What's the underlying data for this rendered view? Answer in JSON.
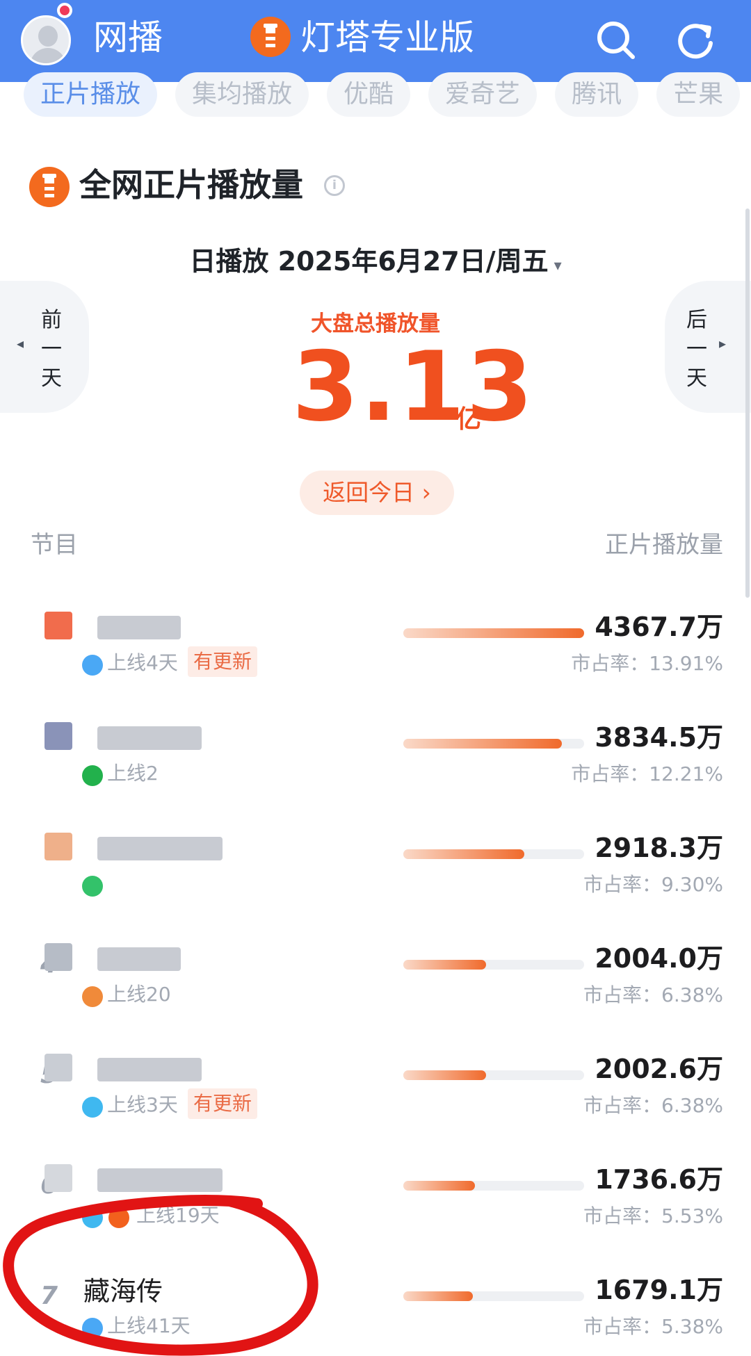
{
  "header": {
    "title": "网播",
    "brand": "灯塔专业版",
    "color": "#4d86f0"
  },
  "tabs": [
    {
      "label": "正片播放",
      "active": true
    },
    {
      "label": "集均播放",
      "active": false
    },
    {
      "label": "优酷",
      "active": false
    },
    {
      "label": "爱奇艺",
      "active": false
    },
    {
      "label": "腾讯",
      "active": false
    },
    {
      "label": "芒果",
      "active": false
    }
  ],
  "section": {
    "title": "全网正片播放量",
    "info_icon": "info-icon"
  },
  "date": {
    "label": "日播放 2025年6月27日/周五",
    "caret": "▾"
  },
  "nav": {
    "prev": "前一天",
    "next": "后一天",
    "prev_arrow": "◂",
    "next_arrow": "▸"
  },
  "total": {
    "label": "大盘总播放量",
    "value": "3.13",
    "unit": "亿"
  },
  "back_today": "返回今日 ›",
  "columns": {
    "left": "节目",
    "right": "正片播放量"
  },
  "rows": [
    {
      "rank": "",
      "title": "",
      "meta": "上线4天",
      "tag": "有更新",
      "plays": "4367.7万",
      "share": "市占率：13.91%",
      "bar": 1.0,
      "platforms": [
        "#4aa8f5"
      ]
    },
    {
      "rank": "",
      "title": "",
      "meta": "上线2",
      "tag": "",
      "plays": "3834.5万",
      "share": "市占率：12.21%",
      "bar": 0.878,
      "platforms": [
        "#22b14c"
      ]
    },
    {
      "rank": "",
      "title": "",
      "meta": "",
      "tag": "",
      "plays": "2918.3万",
      "share": "市占率：9.30%",
      "bar": 0.668,
      "platforms": [
        "#33c26a"
      ]
    },
    {
      "rank": "4",
      "title": "",
      "meta": "上线20",
      "tag": "",
      "plays": "2004.0万",
      "share": "市占率：6.38%",
      "bar": 0.459,
      "platforms": [
        "#f08a3a"
      ]
    },
    {
      "rank": "5",
      "title": "",
      "meta": "上线3天",
      "tag": "有更新",
      "plays": "2002.6万",
      "share": "市占率：6.38%",
      "bar": 0.458,
      "platforms": [
        "#3fb8f0"
      ]
    },
    {
      "rank": "6",
      "title": "",
      "meta": "上线19天",
      "tag": "",
      "plays": "1736.6万",
      "share": "市占率：5.53%",
      "bar": 0.398,
      "platforms": [
        "#3fb8f0",
        "#f2611d"
      ]
    },
    {
      "rank": "7",
      "title": "藏海传",
      "meta": "上线41天",
      "tag": "",
      "plays": "1679.1万",
      "share": "市占率：5.38%",
      "bar": 0.384,
      "platforms": [
        "#4aa8f5"
      ]
    }
  ]
}
